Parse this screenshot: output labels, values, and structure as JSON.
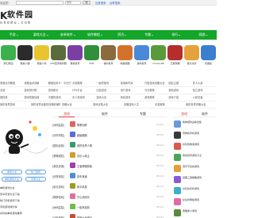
{
  "topbar": {
    "welcome": "欢迎您！",
    "search_button": "搜",
    "select_label": "搜索",
    "links": [
      "百度搜索",
      "谷歌搜索"
    ]
  },
  "logo": {
    "mark": "K",
    "name": "软件园",
    "url": "okemu.com"
  },
  "nav": {
    "items": [
      "手游",
      "游戏大全",
      "安卓软件",
      "软件教程",
      "资讯",
      "专题",
      "排行",
      "网游"
    ],
    "bg_color": "#14a62a"
  },
  "games": [
    {
      "label": "梦幻家园",
      "color": "#3cb04a"
    },
    {
      "label": "像素小镇",
      "color": "#2b2b2b"
    },
    {
      "label": "暴躁小鸟",
      "color": "#e8c431"
    },
    {
      "label": "GTA圣安地列斯",
      "color": "#5a6b3c"
    },
    {
      "label": "像素世界",
      "color": "#7a3fa5"
    },
    {
      "label": "PVZ",
      "color": "#2f8f3a"
    },
    {
      "label": "我的世界",
      "color": "#8b6a3d"
    },
    {
      "label": "地铁跑酷",
      "color": "#d4722b"
    },
    {
      "label": "迷你世界",
      "color": "#4a88d9"
    },
    {
      "label": "minecraft",
      "color": "#5a9a3a"
    },
    {
      "label": "王者荣耀",
      "color": "#b52d2d"
    },
    {
      "label": "蛋仔派对",
      "color": "#e3a23c"
    },
    {
      "label": "饥饿鲨",
      "color": "#3a7ed0"
    }
  ],
  "link_rows": [
    [
      "熊猫对决教程",
      "攻略战术讲解",
      "解锁信用卡：今日只",
      "手游推荐",
      "一起吃饭吗",
      "探索和吃鸡",
      "只是游戏攻略大全",
      "精彩主题",
      "多人小游"
    ],
    [
      "手游",
      "游戏排行榜",
      "游戏助手",
      "CPS平台",
      "比如说说",
      "用户游戏",
      "今日推荐",
      "单机游戏",
      "独立游戏"
    ],
    [
      "奥特曼",
      "游戏快速加速",
      "中国的游戏",
      "无人机游戏",
      "游戏大全",
      "精彩游戏",
      "游戏推荐",
      "游戏介绍",
      "火影忍者"
    ],
    [
      "我的世界游戏",
      "我的世界全能的攻略你懂的",
      "攻略大全",
      "游戏合集大全",
      "攻略游戏人生",
      "手游推荐",
      "我的世界攻略大全"
    ]
  ],
  "left_tags": [
    "游戏大全",
    "热门游戏",
    "单机游戏大全",
    "手游大全"
  ],
  "left_lines": [
    "单机游戏大全",
    "安卓手游大全下载",
    "热门手机游戏下载",
    "手机游戏排行榜",
    "好玩的单机游戏推荐"
  ],
  "mid_tabs": [
    "游戏",
    "软件",
    "专题"
  ],
  "mid_rows": [
    {
      "cat": "[休闲益智]",
      "name": "飘渺仙踪",
      "date": "05-01",
      "color": "#e0635c"
    },
    {
      "cat": "[动作冒险]",
      "name": "超级跑跑",
      "date": "05-01",
      "color": "#5b6be0"
    },
    {
      "cat": "[模拟经营]",
      "name": "我的世界人物",
      "date": "05-01",
      "color": "#3a9a6a"
    },
    {
      "cat": "[策略塔防]",
      "name": "欢乐斗地主",
      "date": "05-01",
      "color": "#d79b2a"
    },
    {
      "cat": "[角色扮演]",
      "name": "王者荣耀新版",
      "date": "05-01",
      "color": "#a53bb0"
    },
    {
      "cat": "[体育竞技]",
      "name": "赛车竞速",
      "date": "05-01",
      "color": "#4a90d9"
    },
    {
      "cat": "[射击游戏]",
      "name": "和平精英",
      "date": "05-01",
      "color": "#9a9a2a"
    },
    {
      "cat": "[棋牌游戏]",
      "name": "开心消消乐",
      "date": "05-01",
      "color": "#e06c9a"
    },
    {
      "cat": "[休闲益智]",
      "name": "一起来捉妖",
      "date": "05-01",
      "color": "#6fbf4a"
    },
    {
      "cat": "[动作冒险]",
      "name": "植物大战僵尸",
      "date": "05-01",
      "color": "#c84a3a"
    }
  ],
  "right_tabs": [
    "游戏",
    "软件"
  ],
  "right_rows": [
    {
      "text": "植物塔防战争合集",
      "color": "#6a9ad9"
    },
    {
      "text": "恐怖的手机游戏",
      "color": "#3a3a3a"
    },
    {
      "text": "好玩的像素游戏",
      "color": "#d95a4a"
    },
    {
      "text": "我的世界游戏大全",
      "color": "#4aa55a"
    },
    {
      "text": "音乐节奏类游戏",
      "color": "#e3a03a"
    },
    {
      "text": "经典三国策略游戏",
      "color": "#8a5ad9"
    },
    {
      "text": "好玩的手机游戏",
      "color": "#3ab0c9"
    },
    {
      "text": "女生的网络游戏",
      "color": "#e06aa5"
    },
    {
      "text": "跑酷类小游戏",
      "color": "#5a8a3a"
    }
  ],
  "colors": {
    "accent_red": "#e23c3c",
    "link_blue": "#2a6fc9"
  }
}
